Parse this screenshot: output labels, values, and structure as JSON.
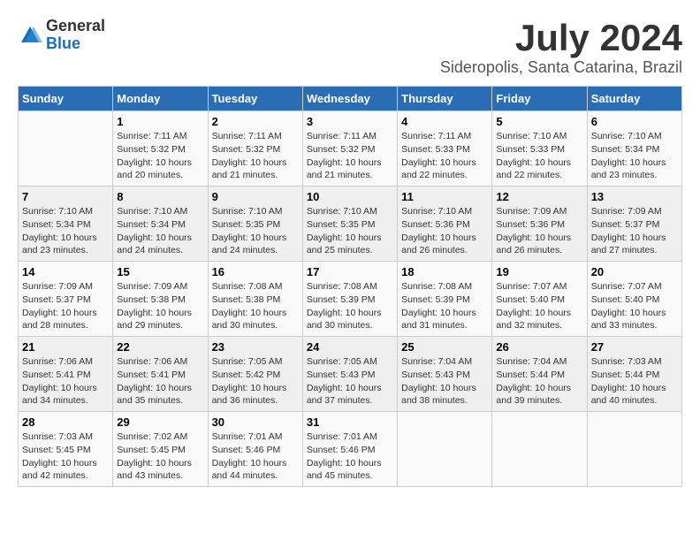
{
  "logo": {
    "general": "General",
    "blue": "Blue"
  },
  "title": "July 2024",
  "subtitle": "Sideropolis, Santa Catarina, Brazil",
  "headers": [
    "Sunday",
    "Monday",
    "Tuesday",
    "Wednesday",
    "Thursday",
    "Friday",
    "Saturday"
  ],
  "weeks": [
    [
      {
        "day": "",
        "info": ""
      },
      {
        "day": "1",
        "info": "Sunrise: 7:11 AM\nSunset: 5:32 PM\nDaylight: 10 hours\nand 20 minutes."
      },
      {
        "day": "2",
        "info": "Sunrise: 7:11 AM\nSunset: 5:32 PM\nDaylight: 10 hours\nand 21 minutes."
      },
      {
        "day": "3",
        "info": "Sunrise: 7:11 AM\nSunset: 5:32 PM\nDaylight: 10 hours\nand 21 minutes."
      },
      {
        "day": "4",
        "info": "Sunrise: 7:11 AM\nSunset: 5:33 PM\nDaylight: 10 hours\nand 22 minutes."
      },
      {
        "day": "5",
        "info": "Sunrise: 7:10 AM\nSunset: 5:33 PM\nDaylight: 10 hours\nand 22 minutes."
      },
      {
        "day": "6",
        "info": "Sunrise: 7:10 AM\nSunset: 5:34 PM\nDaylight: 10 hours\nand 23 minutes."
      }
    ],
    [
      {
        "day": "7",
        "info": "Sunrise: 7:10 AM\nSunset: 5:34 PM\nDaylight: 10 hours\nand 23 minutes."
      },
      {
        "day": "8",
        "info": "Sunrise: 7:10 AM\nSunset: 5:34 PM\nDaylight: 10 hours\nand 24 minutes."
      },
      {
        "day": "9",
        "info": "Sunrise: 7:10 AM\nSunset: 5:35 PM\nDaylight: 10 hours\nand 24 minutes."
      },
      {
        "day": "10",
        "info": "Sunrise: 7:10 AM\nSunset: 5:35 PM\nDaylight: 10 hours\nand 25 minutes."
      },
      {
        "day": "11",
        "info": "Sunrise: 7:10 AM\nSunset: 5:36 PM\nDaylight: 10 hours\nand 26 minutes."
      },
      {
        "day": "12",
        "info": "Sunrise: 7:09 AM\nSunset: 5:36 PM\nDaylight: 10 hours\nand 26 minutes."
      },
      {
        "day": "13",
        "info": "Sunrise: 7:09 AM\nSunset: 5:37 PM\nDaylight: 10 hours\nand 27 minutes."
      }
    ],
    [
      {
        "day": "14",
        "info": "Sunrise: 7:09 AM\nSunset: 5:37 PM\nDaylight: 10 hours\nand 28 minutes."
      },
      {
        "day": "15",
        "info": "Sunrise: 7:09 AM\nSunset: 5:38 PM\nDaylight: 10 hours\nand 29 minutes."
      },
      {
        "day": "16",
        "info": "Sunrise: 7:08 AM\nSunset: 5:38 PM\nDaylight: 10 hours\nand 30 minutes."
      },
      {
        "day": "17",
        "info": "Sunrise: 7:08 AM\nSunset: 5:39 PM\nDaylight: 10 hours\nand 30 minutes."
      },
      {
        "day": "18",
        "info": "Sunrise: 7:08 AM\nSunset: 5:39 PM\nDaylight: 10 hours\nand 31 minutes."
      },
      {
        "day": "19",
        "info": "Sunrise: 7:07 AM\nSunset: 5:40 PM\nDaylight: 10 hours\nand 32 minutes."
      },
      {
        "day": "20",
        "info": "Sunrise: 7:07 AM\nSunset: 5:40 PM\nDaylight: 10 hours\nand 33 minutes."
      }
    ],
    [
      {
        "day": "21",
        "info": "Sunrise: 7:06 AM\nSunset: 5:41 PM\nDaylight: 10 hours\nand 34 minutes."
      },
      {
        "day": "22",
        "info": "Sunrise: 7:06 AM\nSunset: 5:41 PM\nDaylight: 10 hours\nand 35 minutes."
      },
      {
        "day": "23",
        "info": "Sunrise: 7:05 AM\nSunset: 5:42 PM\nDaylight: 10 hours\nand 36 minutes."
      },
      {
        "day": "24",
        "info": "Sunrise: 7:05 AM\nSunset: 5:43 PM\nDaylight: 10 hours\nand 37 minutes."
      },
      {
        "day": "25",
        "info": "Sunrise: 7:04 AM\nSunset: 5:43 PM\nDaylight: 10 hours\nand 38 minutes."
      },
      {
        "day": "26",
        "info": "Sunrise: 7:04 AM\nSunset: 5:44 PM\nDaylight: 10 hours\nand 39 minutes."
      },
      {
        "day": "27",
        "info": "Sunrise: 7:03 AM\nSunset: 5:44 PM\nDaylight: 10 hours\nand 40 minutes."
      }
    ],
    [
      {
        "day": "28",
        "info": "Sunrise: 7:03 AM\nSunset: 5:45 PM\nDaylight: 10 hours\nand 42 minutes."
      },
      {
        "day": "29",
        "info": "Sunrise: 7:02 AM\nSunset: 5:45 PM\nDaylight: 10 hours\nand 43 minutes."
      },
      {
        "day": "30",
        "info": "Sunrise: 7:01 AM\nSunset: 5:46 PM\nDaylight: 10 hours\nand 44 minutes."
      },
      {
        "day": "31",
        "info": "Sunrise: 7:01 AM\nSunset: 5:46 PM\nDaylight: 10 hours\nand 45 minutes."
      },
      {
        "day": "",
        "info": ""
      },
      {
        "day": "",
        "info": ""
      },
      {
        "day": "",
        "info": ""
      }
    ]
  ]
}
